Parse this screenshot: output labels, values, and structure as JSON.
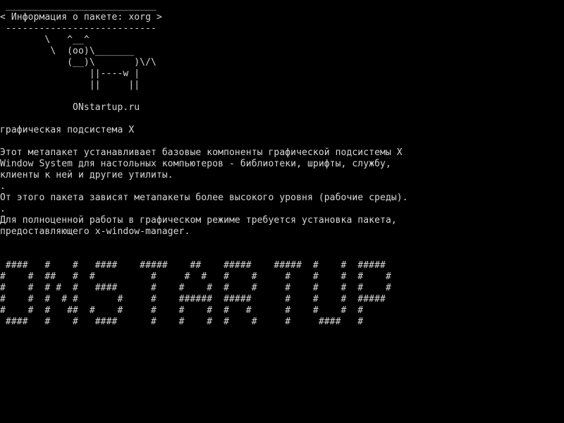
{
  "terminal": {
    "background": "#000000",
    "foreground": "#d8d8d8",
    "lines": [
      " ___________________________",
      "< Информация о пакете: xorg >",
      " ---------------------------",
      "        \\   ^__^",
      "         \\  (oo)\\_______",
      "            (__)\\       )\\/\\",
      "                ||----w |",
      "                ||     ||",
      "",
      "             ONstartup.ru",
      "",
      "графическая подсистема X",
      "",
      "Этот метапакет устанавливает базовые компоненты графической подсистемы X",
      "Window System для настольных компьютеров - библиотеки, шрифты, службу,",
      "клиенты к ней и другие утилиты.",
      ".",
      "От этого пакета зависят метапакеты более высокого уровня (рабочие среды).",
      ".",
      "Для полноценной работы в графическом режиме требуется установка пакета,",
      "предоставляющего x-window-manager."
    ],
    "banner": [
      " ####   #    #   ####    #####    ##    #####    #####  #    #  #####",
      "#    #  ##   #  #          #     #  #   #    #     #    #    #  #    #",
      "#    #  # #  #   ####      #    #    #  #    #     #    #    #  #    #",
      "#    #  #  # #       #     #    ######  #####      #    #    #  #####",
      "#    #  #   ##  #    #     #    #    #  #   #      #    #    #  #",
      " ####   #    #   ####      #    #    #  #    #     #     ####   #"
    ]
  }
}
